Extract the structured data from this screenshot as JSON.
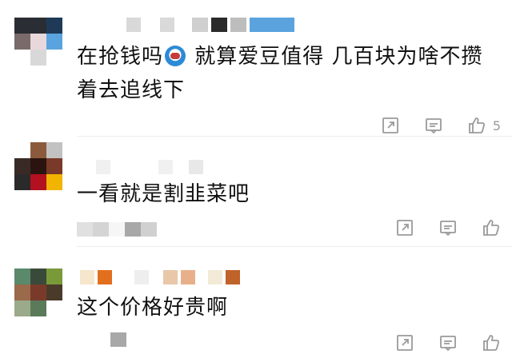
{
  "comments": [
    {
      "text_before": "在抢钱吗",
      "emoji_name": "shocked-face-emoji",
      "text_after": " 就算爱豆值得 几百块为啥不攒着去追线下",
      "like_count": "5",
      "avatar_colors": [
        "#2a2d33",
        "#2a2d33",
        "#1f3a57",
        "#7a6a6a",
        "#e8d8dc",
        "#5aa3de",
        "#ffffff",
        "#d8d8d8",
        "#ffffff"
      ],
      "name_colors": [
        "#d9d9d9",
        "#d9d9d9",
        "#cfcfcf",
        "#2a2a2a",
        "#bdbdbd",
        "#5aa3de"
      ]
    },
    {
      "text": "一看就是割韭菜吧",
      "like_count": "",
      "avatar_colors": [
        "#c2c2c2",
        "#8b5a3c",
        "#c2c2c2",
        "#3a2a26",
        "#2b1410",
        "#7a3a2a",
        "#2a2a2a",
        "#b31020",
        "#f1b400"
      ],
      "name_colors": [
        "#f0f0f0",
        "#f0f0f0",
        "#e8e8e8",
        "#e8e8e8"
      ],
      "meta_colors": [
        "#e0e0e0",
        "#d4d4d4",
        "#a8a8a8",
        "#d0d0d0"
      ]
    },
    {
      "text": "这个价格好贵啊",
      "like_count": "",
      "avatar_colors": [
        "#5a8a6a",
        "#3a4a3a",
        "#7a9a3a",
        "#9a6a4a",
        "#7a3a2a",
        "#4a3a2a",
        "#9aaa8a",
        "#5a7a5a",
        "#ffffff"
      ],
      "name_colors": [
        "#f5e6cc",
        "#e26f1d",
        "#eee",
        "#e8c8a8",
        "#e8b08a",
        "#f2ead6",
        "#c0622a"
      ],
      "meta_colors": [
        "#a8a8a8"
      ]
    }
  ],
  "icons": {
    "share": "share-icon",
    "reply": "comment-icon",
    "like": "like-icon"
  }
}
